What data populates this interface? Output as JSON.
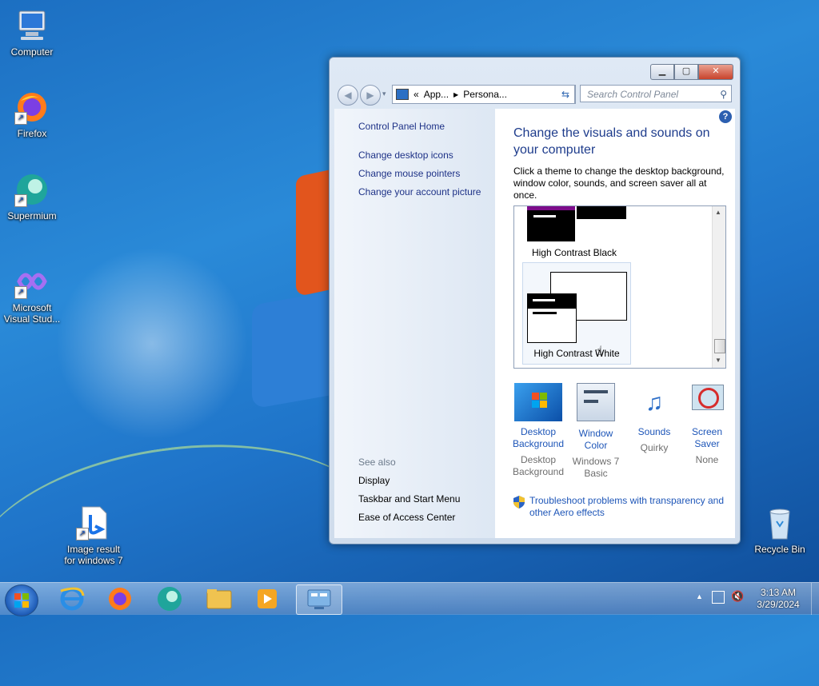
{
  "desktop": {
    "icons": [
      {
        "label": "Computer"
      },
      {
        "label": "Firefox"
      },
      {
        "label": "Supermium"
      },
      {
        "label": "Microsoft Visual Stud..."
      },
      {
        "label": "Image result for windows 7"
      },
      {
        "label": "Recycle Bin"
      }
    ]
  },
  "window": {
    "address": {
      "segment1": "App...",
      "segment2": "Persona..."
    },
    "search_placeholder": "Search Control Panel",
    "left_pane": {
      "home": "Control Panel Home",
      "links": [
        "Change desktop icons",
        "Change mouse pointers",
        "Change your account picture"
      ],
      "see_also_label": "See also",
      "see_also": [
        "Display",
        "Taskbar and Start Menu",
        "Ease of Access Center"
      ]
    },
    "heading": "Change the visuals and sounds on your computer",
    "description": "Click a theme to change the desktop background, window color, sounds, and screen saver all at once.",
    "themes": [
      {
        "name": "High Contrast Black"
      },
      {
        "name": "High Contrast White",
        "selected": true
      }
    ],
    "options": [
      {
        "label": "Desktop Background",
        "value": "Desktop Background",
        "icon": "desktop-background-icon"
      },
      {
        "label": "Window Color",
        "value": "Windows 7 Basic",
        "icon": "window-color-icon"
      },
      {
        "label": "Sounds",
        "value": "Quirky",
        "icon": "sounds-icon"
      },
      {
        "label": "Screen Saver",
        "value": "None",
        "icon": "screen-saver-icon"
      }
    ],
    "troubleshoot": "Troubleshoot problems with transparency and other Aero effects"
  },
  "taskbar": {
    "time": "3:13 AM",
    "date": "3/29/2024"
  }
}
